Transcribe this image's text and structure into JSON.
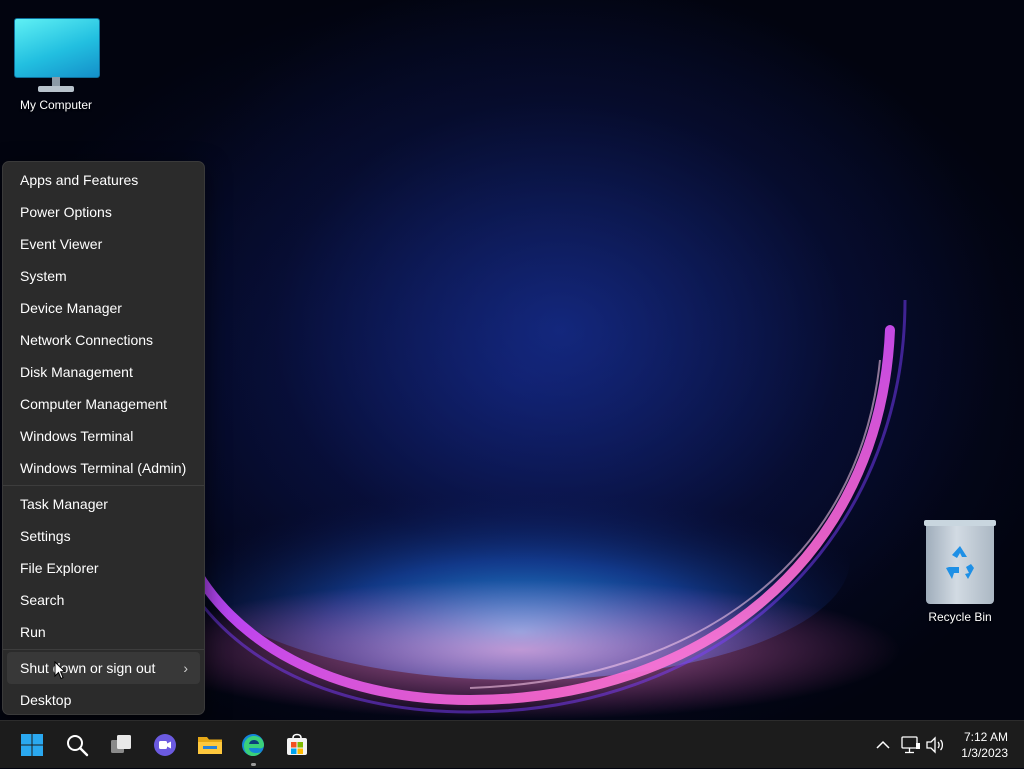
{
  "desktop": {
    "icons": [
      {
        "label": "My Computer"
      },
      {
        "label": "Recycle Bin"
      }
    ]
  },
  "context_menu": {
    "group1": [
      {
        "label": "Apps and Features"
      },
      {
        "label": "Power Options"
      },
      {
        "label": "Event Viewer"
      },
      {
        "label": "System"
      },
      {
        "label": "Device Manager"
      },
      {
        "label": "Network Connections"
      },
      {
        "label": "Disk Management"
      },
      {
        "label": "Computer Management"
      },
      {
        "label": "Windows Terminal"
      },
      {
        "label": "Windows Terminal (Admin)"
      }
    ],
    "group2": [
      {
        "label": "Task Manager"
      },
      {
        "label": "Settings"
      },
      {
        "label": "File Explorer"
      },
      {
        "label": "Search"
      },
      {
        "label": "Run"
      }
    ],
    "group3": [
      {
        "label": "Shut down or sign out",
        "submenu": true
      },
      {
        "label": "Desktop"
      }
    ]
  },
  "taskbar": {
    "apps": [
      "start-icon",
      "search-icon",
      "task-view-icon",
      "chat-icon",
      "file-explorer-icon",
      "edge-icon",
      "store-icon"
    ],
    "tray": [
      "chevron-up-icon",
      "network-icon",
      "volume-icon"
    ],
    "clock": {
      "time": "7:12 AM",
      "date": "1/3/2023"
    }
  },
  "colors": {
    "accent": "#0078d4",
    "menu_bg": "#2b2b2b",
    "taskbar_bg": "#1c1c1c"
  }
}
